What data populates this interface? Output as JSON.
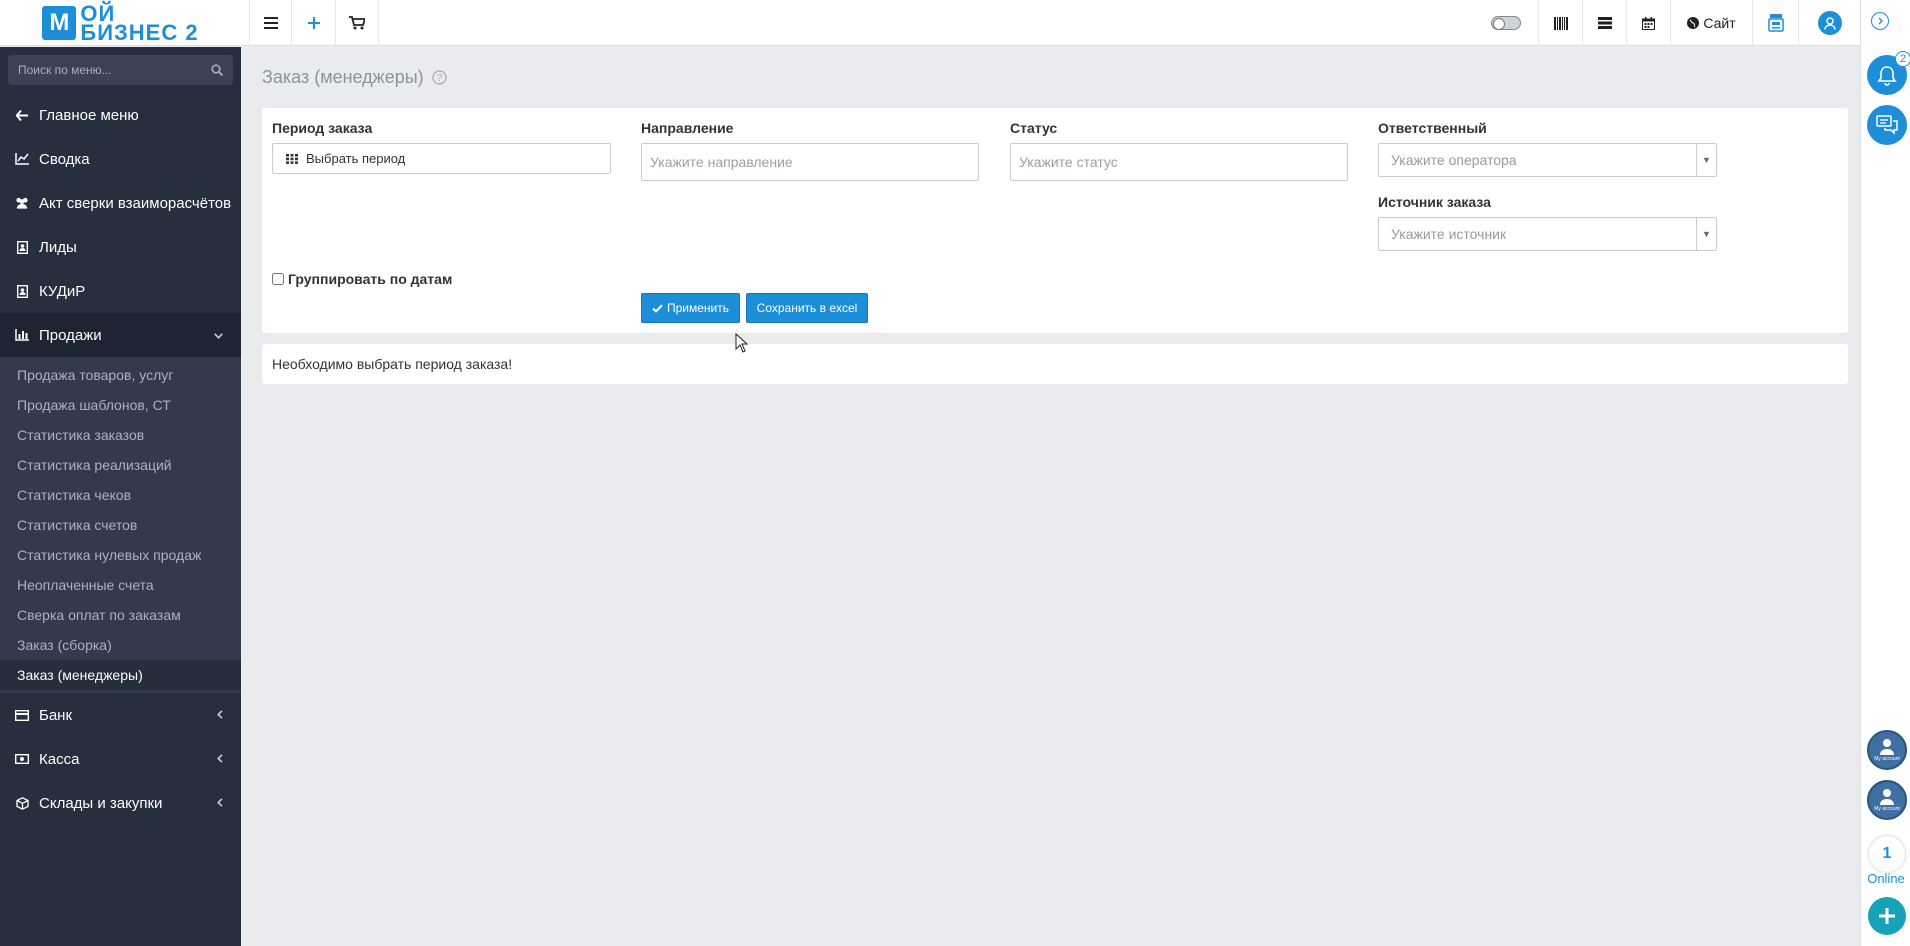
{
  "brand": {
    "logo_mark": "М",
    "logo_line1": "ОЙ",
    "logo_line2": "БИЗНЕС 2",
    "accent": "#1d8fd9"
  },
  "topbar": {
    "icons": [
      "menu-icon",
      "plus-icon",
      "cart-icon"
    ],
    "right_icons": [
      "toggle-switch",
      "barcode-icon",
      "server-icon",
      "calendar-icon",
      "globe-icon",
      "cashbox-icon",
      "user-icon"
    ],
    "site_label": "Сайт"
  },
  "sidebar": {
    "search_placeholder": "Поиск по меню...",
    "items": [
      {
        "label": "Главное меню",
        "icon": "arrow-left-icon"
      },
      {
        "label": "Сводка",
        "icon": "line-chart-icon"
      },
      {
        "label": "Акт сверки взаиморасчётов",
        "icon": "users-icon"
      },
      {
        "label": "Лиды",
        "icon": "contact-card-icon"
      },
      {
        "label": "КУДиР",
        "icon": "contact-card-icon"
      },
      {
        "label": "Продажи",
        "icon": "bar-chart-icon"
      }
    ],
    "sales_sub": [
      "Продажа товаров, услуг",
      "Продажа шаблонов, СТ",
      "Статистика заказов",
      "Статистика реализаций",
      "Статистика чеков",
      "Статистика счетов",
      "Статистика нулевых продаж",
      "Неоплаченные счета",
      "Сверка оплат по заказам",
      "Заказ (сборка)",
      "Заказ (менеджеры)"
    ],
    "bottom_items": [
      {
        "label": "Банк",
        "icon": "credit-card-icon"
      },
      {
        "label": "Касса",
        "icon": "money-icon"
      },
      {
        "label": "Склады и закупки",
        "icon": "box-icon"
      }
    ]
  },
  "page": {
    "title": "Заказ (менеджеры)"
  },
  "filters": {
    "period_label": "Период заказа",
    "period_button": "Выбрать период",
    "direction_label": "Направление",
    "direction_placeholder": "Укажите направление",
    "status_label": "Статус",
    "status_placeholder": "Укажите статус",
    "responsible_label": "Ответственный",
    "responsible_placeholder": "Укажите оператора",
    "source_label": "Источник заказа",
    "source_placeholder": "Укажите источник",
    "group_by_dates": "Группировать по датам",
    "group_checked": false,
    "apply_button": "Применить",
    "excel_button": "Сохранить в excel"
  },
  "message": "Необходимо выбрать период заказа!",
  "rail": {
    "notify_badge": "2",
    "online_count": "1",
    "online_label": "Online",
    "account_label": "My account"
  }
}
